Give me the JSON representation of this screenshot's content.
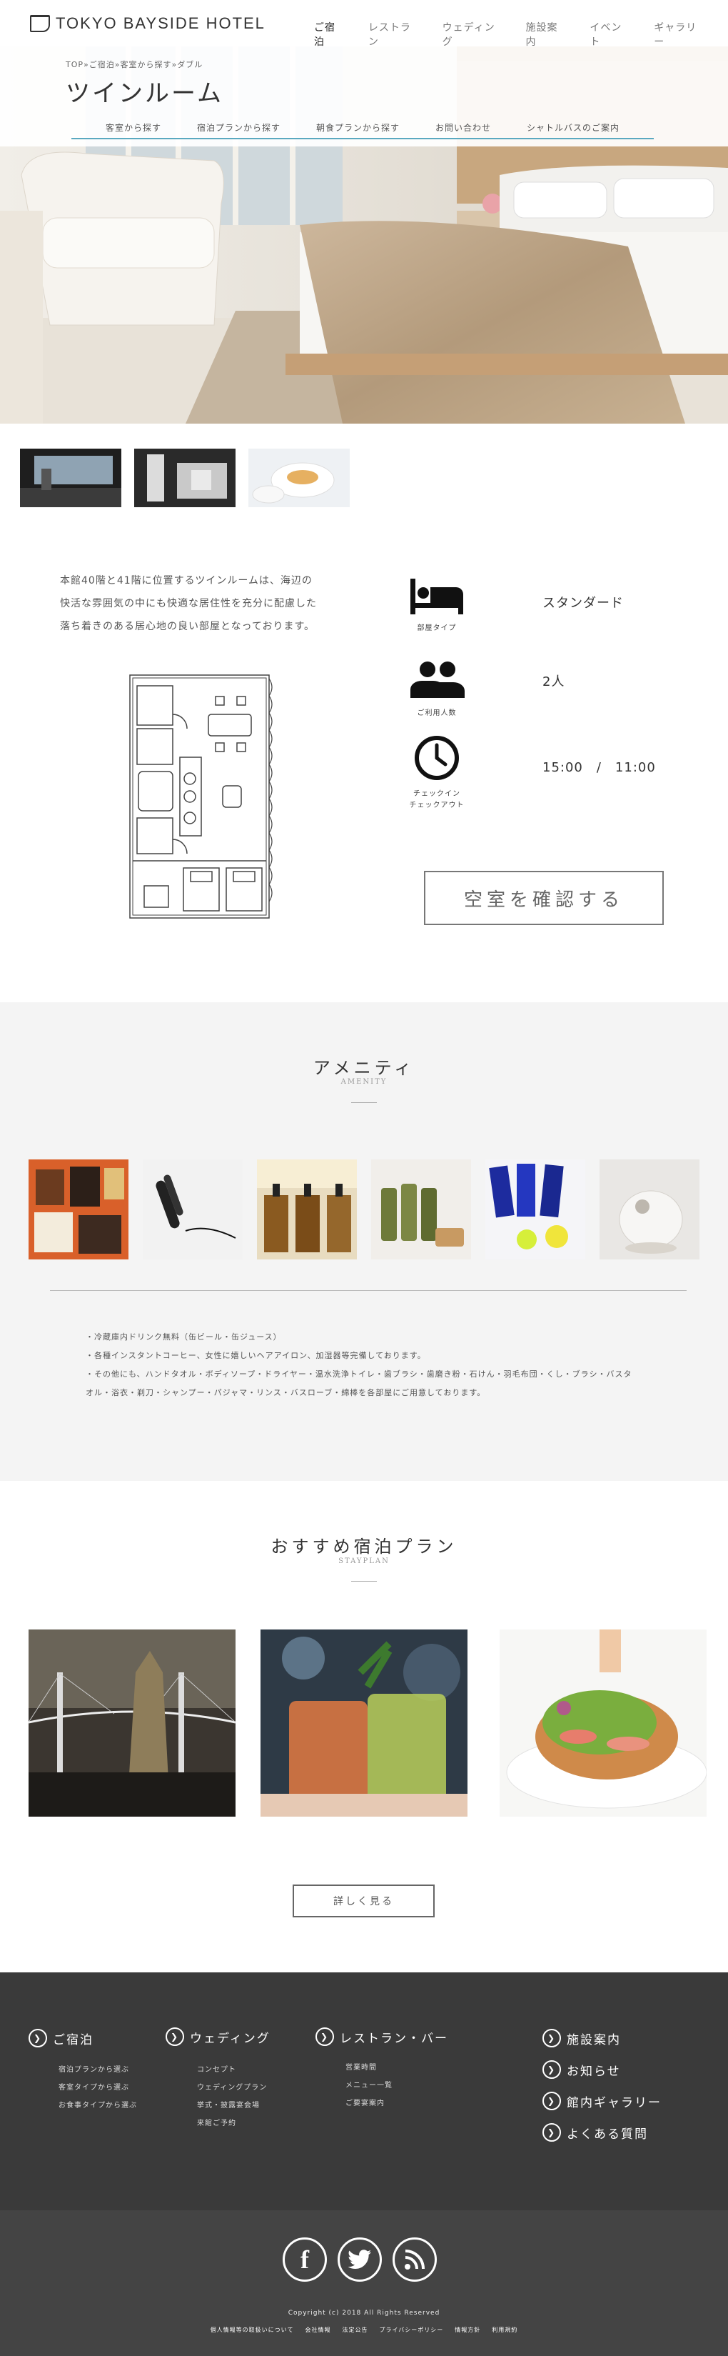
{
  "header": {
    "logo_text": "TOKYO BAYSIDE HOTEL",
    "nav": [
      "ご宿泊",
      "レストラン",
      "ウェディング",
      "施設案内",
      "イベント",
      "ギャラリー"
    ]
  },
  "subheader": {
    "breadcrumb": "TOP»ご宿泊»客室から探す»ダブル",
    "title": "ツインルーム",
    "nav": [
      "客室から探す",
      "宿泊プランから探す",
      "朝食プランから探す",
      "お問い合わせ",
      "シャトルバスのご案内"
    ]
  },
  "room": {
    "description_lines": [
      "本館40階と41階に位置するツインルームは、海辺の",
      "快活な雰囲気の中にも快適な居住性を充分に配慮した",
      "落ち着きのある居心地の良い部屋となっております。"
    ],
    "specs": [
      {
        "icon": "bed-icon",
        "label": "部屋タイプ",
        "value": "スタンダード"
      },
      {
        "icon": "people-icon",
        "label": "ご利用人数",
        "value": "2人"
      },
      {
        "icon": "clock-icon",
        "label_lines": [
          "チェックイン",
          "チェックアウト"
        ],
        "value": "15:00　/　11:00"
      }
    ],
    "check_button": "空室を確認する"
  },
  "amenity": {
    "title": "アメニティ",
    "subtitle": "AMENITY",
    "notes": [
      "・冷蔵庫内ドリンク無料（缶ビール・缶ジュース）",
      "・各種インスタントコーヒー、女性に嬉しいヘアアイロン、加湿器等完備しております。",
      "・その他にも、ハンドタオル・ボディソープ・ドライヤー・温水洗浄トイレ・歯ブラシ・歯磨き粉・石けん・羽毛布団・くし・ブラシ・バスタ",
      "オル・浴衣・剃刀・シャンプー・パジャマ・リンス・バスローブ・綿棒を各部屋にご用意しております。"
    ]
  },
  "stayplan": {
    "title": "おすすめ宿泊プラン",
    "subtitle": "STAYPLAN",
    "more_button": "詳しく見る"
  },
  "footer": {
    "columns": [
      {
        "heading": "ご宿泊",
        "links": [
          "宿泊プランから選ぶ",
          "客室タイプから選ぶ",
          "お食事タイプから選ぶ"
        ]
      },
      {
        "heading": "ウェディング",
        "links": [
          "コンセプト",
          "ウェディングプラン",
          "挙式・披露宴会場",
          "来館ご予約"
        ]
      },
      {
        "heading": "レストラン・バー",
        "links": [
          "営業時間",
          "メニュー一覧",
          "ご要宴案内"
        ]
      }
    ],
    "right_links": [
      "施設案内",
      "お知らせ",
      "館内ギャラリー",
      "よくある質問"
    ],
    "social": [
      "facebook-icon",
      "twitter-icon",
      "rss-icon"
    ],
    "copyright": "Copyright (c) 2018 All Rights Reserved",
    "legal": [
      "個人情報等の取扱いについて",
      "会社情報",
      "法定公告",
      "プライバシーポリシー",
      "情報方針",
      "利用規約"
    ]
  }
}
